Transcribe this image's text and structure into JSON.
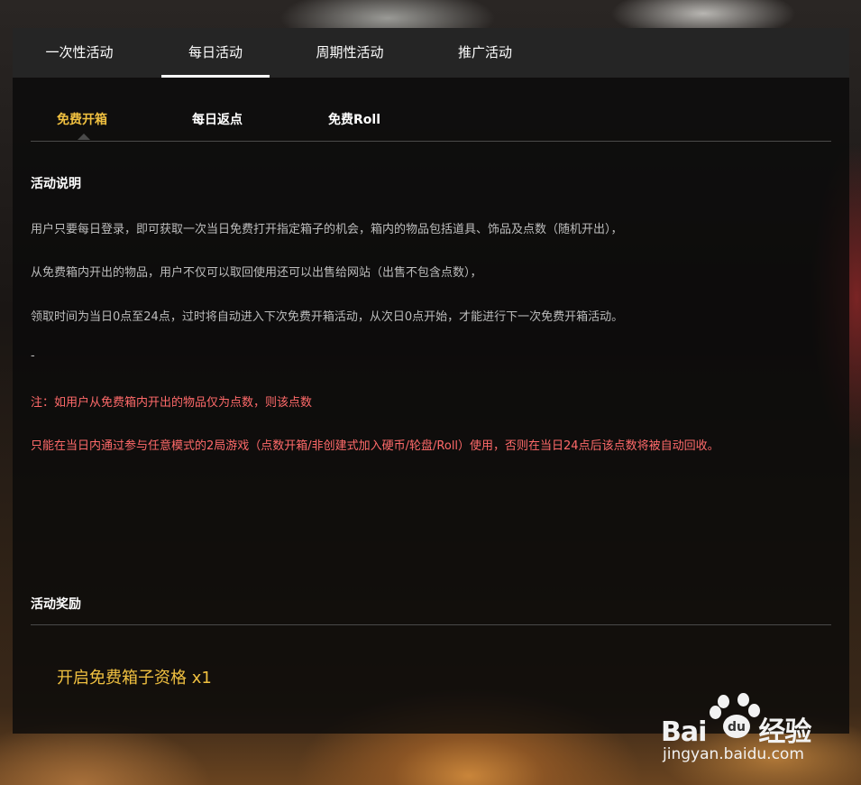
{
  "main_tabs": [
    {
      "label": "一次性活动"
    },
    {
      "label": "每日活动"
    },
    {
      "label": "周期性活动"
    },
    {
      "label": "推广活动"
    }
  ],
  "active_main_tab": "每日活动",
  "sub_tabs": [
    {
      "label": "免费开箱"
    },
    {
      "label": "每日返点"
    },
    {
      "label": "免费Roll"
    }
  ],
  "active_sub_tab": "免费开箱",
  "description": {
    "title": "活动说明",
    "lines": [
      "用户只要每日登录，即可获取一次当日免费打开指定箱子的机会，箱内的物品包括道具、饰品及点数（随机开出），",
      "从免费箱内开出的物品，用户不仅可以取回使用还可以出售给网站（出售不包含点数），",
      "领取时间为当日0点至24点，过时将自动进入下次免费开箱活动，从次日0点开始，才能进行下一次免费开箱活动。",
      "-"
    ],
    "notes": [
      "注：如用户从免费箱内开出的物品仅为点数，则该点数",
      "只能在当日内通过参与任意模式的2局游戏（点数开箱/非创建式加入硬币/轮盘/Roll）使用，否则在当日24点后该点数将被自动回收。"
    ]
  },
  "reward": {
    "title": "活动奖励",
    "item": "开启免费箱子资格 x1"
  },
  "watermark": {
    "logo_left": "Bai",
    "logo_paw": "du",
    "logo_right": "经验",
    "url": "jingyan.baidu.com"
  },
  "colors": {
    "accent": "#f0c040",
    "note_red": "#ff6a6a",
    "tab_bar": "#252525"
  }
}
